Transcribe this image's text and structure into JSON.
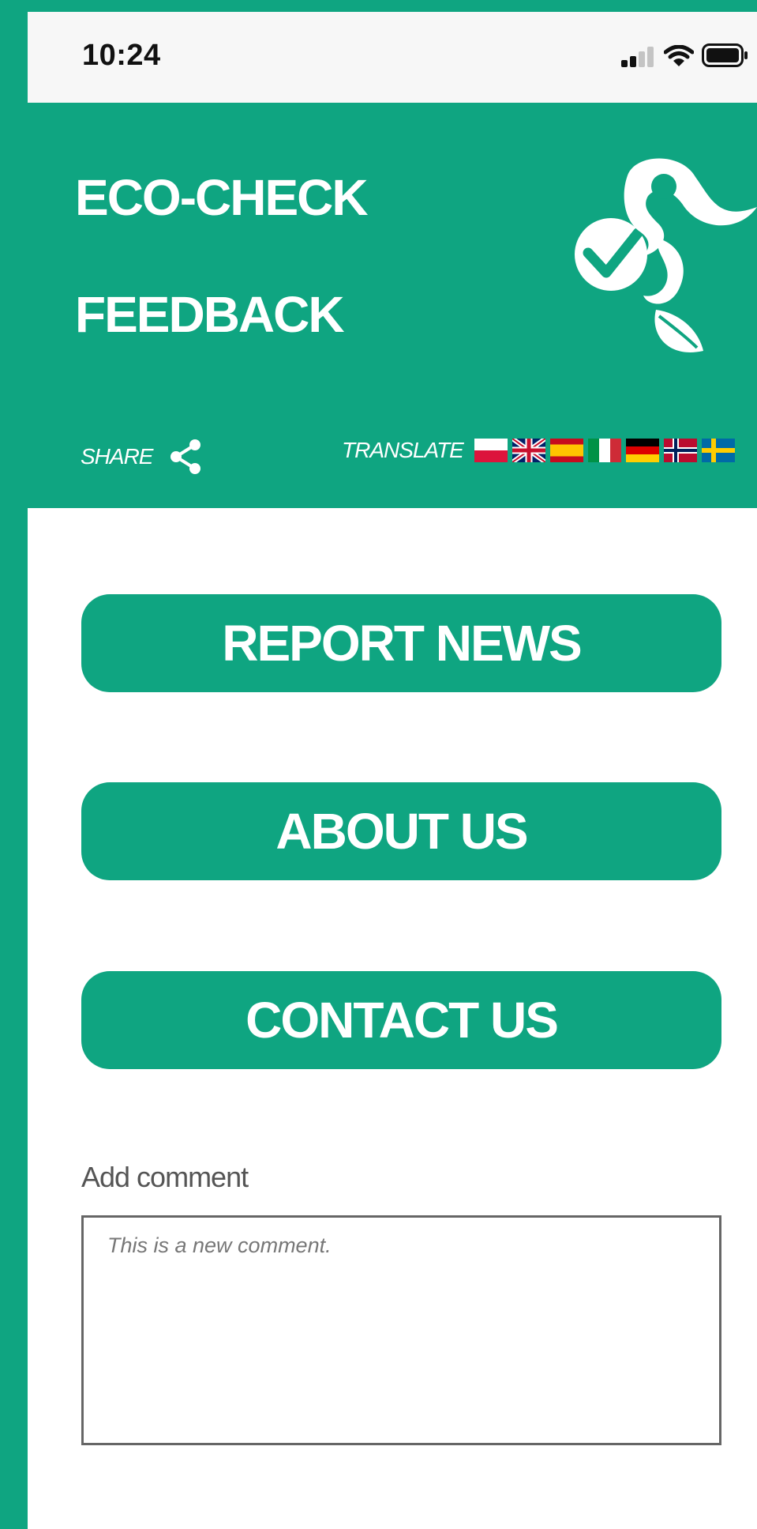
{
  "status_bar": {
    "time": "10:24",
    "icons": [
      "cellular-signal-icon",
      "wifi-icon",
      "battery-icon"
    ]
  },
  "header": {
    "title_line1": "ECO-CHECK",
    "title_line2": "FEEDBACK",
    "logo_icon": "eco-check-logo-icon",
    "share_label": "SHARE",
    "share_icon": "share-icon",
    "translate_label": "TRANSLATE",
    "flags": [
      "Poland",
      "United Kingdom",
      "Spain",
      "Italy",
      "Germany",
      "Norway",
      "Sweden"
    ]
  },
  "menu": {
    "report_news": "REPORT NEWS",
    "about_us": "ABOUT US",
    "contact_us": "CONTACT US"
  },
  "comment": {
    "label": "Add comment",
    "placeholder": "This is a new comment.",
    "value": ""
  },
  "colors": {
    "brand_green": "#0fa581",
    "white": "#ffffff",
    "status_bar_bg": "#f7f7f7",
    "label_gray": "#555555"
  }
}
